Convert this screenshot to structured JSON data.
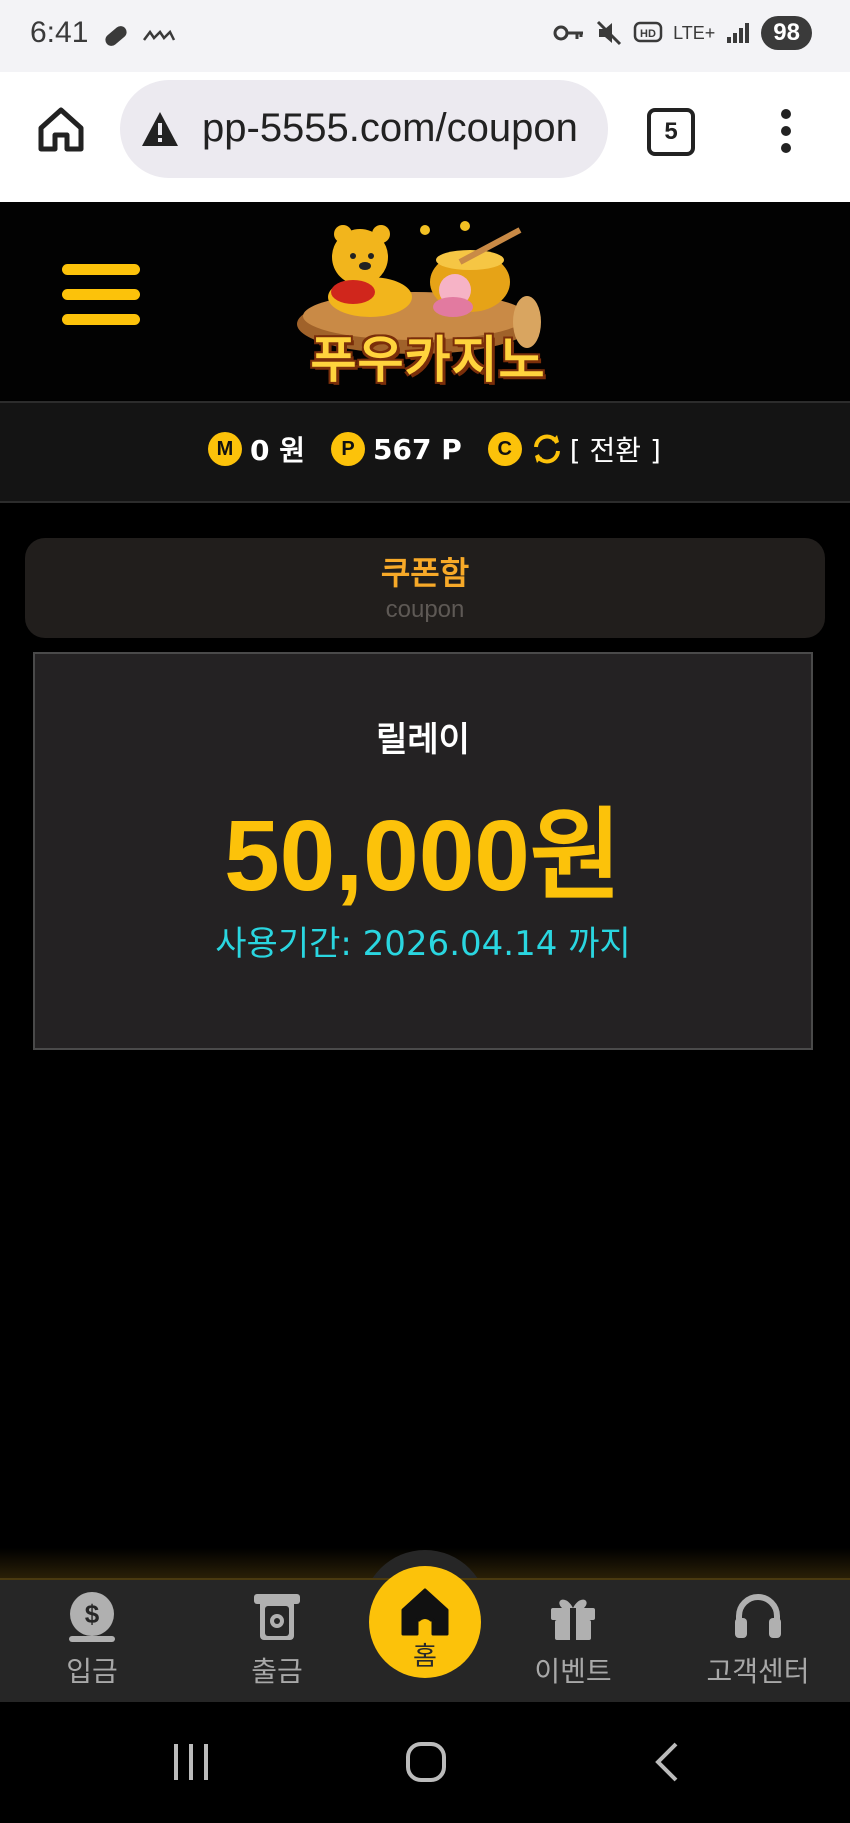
{
  "status_bar": {
    "time": "6:41",
    "icons": [
      "pill-icon",
      "kakao-icon",
      "key-icon",
      "mute-icon",
      "hd-icon",
      "lte-icon",
      "signal-icon"
    ],
    "lte_label": "LTE+",
    "battery": "98"
  },
  "browser": {
    "url": "pp-5555.com/coupon",
    "tab_count": "5"
  },
  "header": {
    "logo_text": "푸우카지노"
  },
  "balance": {
    "money_badge": "M",
    "money_value": "0 원",
    "point_badge": "P",
    "point_value": "567 P",
    "casino_badge": "C",
    "convert_label": "[ 전환 ]"
  },
  "coupon_section": {
    "title": "쿠폰함",
    "subtitle": "coupon"
  },
  "coupon": {
    "name": "릴레이",
    "amount": "50,000원",
    "expiry": "사용기간: 2026.04.14 까지"
  },
  "bottom_nav": {
    "items": [
      {
        "label": "입금",
        "icon": "dollar-coin-icon"
      },
      {
        "label": "출금",
        "icon": "atm-icon"
      },
      {
        "label": "홈",
        "icon": "home-icon"
      },
      {
        "label": "이벤트",
        "icon": "gift-icon"
      },
      {
        "label": "고객센터",
        "icon": "headset-icon"
      }
    ]
  },
  "colors": {
    "accent": "#fcc20a",
    "coupon_title": "#f7a928",
    "expiry": "#2ad6e0",
    "background": "#000000"
  }
}
